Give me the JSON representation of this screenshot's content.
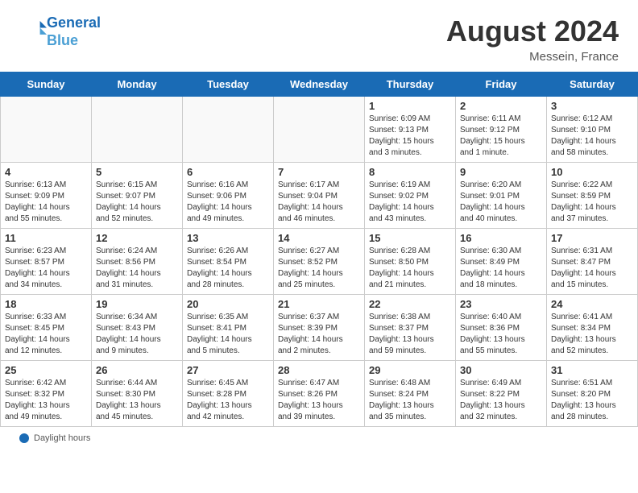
{
  "header": {
    "logo_line1": "General",
    "logo_line2": "Blue",
    "month_title": "August 2024",
    "location": "Messein, France"
  },
  "days_of_week": [
    "Sunday",
    "Monday",
    "Tuesday",
    "Wednesday",
    "Thursday",
    "Friday",
    "Saturday"
  ],
  "footer": {
    "label": "Daylight hours"
  },
  "weeks": [
    [
      {
        "day": "",
        "info": ""
      },
      {
        "day": "",
        "info": ""
      },
      {
        "day": "",
        "info": ""
      },
      {
        "day": "",
        "info": ""
      },
      {
        "day": "1",
        "info": "Sunrise: 6:09 AM\nSunset: 9:13 PM\nDaylight: 15 hours\nand 3 minutes."
      },
      {
        "day": "2",
        "info": "Sunrise: 6:11 AM\nSunset: 9:12 PM\nDaylight: 15 hours\nand 1 minute."
      },
      {
        "day": "3",
        "info": "Sunrise: 6:12 AM\nSunset: 9:10 PM\nDaylight: 14 hours\nand 58 minutes."
      }
    ],
    [
      {
        "day": "4",
        "info": "Sunrise: 6:13 AM\nSunset: 9:09 PM\nDaylight: 14 hours\nand 55 minutes."
      },
      {
        "day": "5",
        "info": "Sunrise: 6:15 AM\nSunset: 9:07 PM\nDaylight: 14 hours\nand 52 minutes."
      },
      {
        "day": "6",
        "info": "Sunrise: 6:16 AM\nSunset: 9:06 PM\nDaylight: 14 hours\nand 49 minutes."
      },
      {
        "day": "7",
        "info": "Sunrise: 6:17 AM\nSunset: 9:04 PM\nDaylight: 14 hours\nand 46 minutes."
      },
      {
        "day": "8",
        "info": "Sunrise: 6:19 AM\nSunset: 9:02 PM\nDaylight: 14 hours\nand 43 minutes."
      },
      {
        "day": "9",
        "info": "Sunrise: 6:20 AM\nSunset: 9:01 PM\nDaylight: 14 hours\nand 40 minutes."
      },
      {
        "day": "10",
        "info": "Sunrise: 6:22 AM\nSunset: 8:59 PM\nDaylight: 14 hours\nand 37 minutes."
      }
    ],
    [
      {
        "day": "11",
        "info": "Sunrise: 6:23 AM\nSunset: 8:57 PM\nDaylight: 14 hours\nand 34 minutes."
      },
      {
        "day": "12",
        "info": "Sunrise: 6:24 AM\nSunset: 8:56 PM\nDaylight: 14 hours\nand 31 minutes."
      },
      {
        "day": "13",
        "info": "Sunrise: 6:26 AM\nSunset: 8:54 PM\nDaylight: 14 hours\nand 28 minutes."
      },
      {
        "day": "14",
        "info": "Sunrise: 6:27 AM\nSunset: 8:52 PM\nDaylight: 14 hours\nand 25 minutes."
      },
      {
        "day": "15",
        "info": "Sunrise: 6:28 AM\nSunset: 8:50 PM\nDaylight: 14 hours\nand 21 minutes."
      },
      {
        "day": "16",
        "info": "Sunrise: 6:30 AM\nSunset: 8:49 PM\nDaylight: 14 hours\nand 18 minutes."
      },
      {
        "day": "17",
        "info": "Sunrise: 6:31 AM\nSunset: 8:47 PM\nDaylight: 14 hours\nand 15 minutes."
      }
    ],
    [
      {
        "day": "18",
        "info": "Sunrise: 6:33 AM\nSunset: 8:45 PM\nDaylight: 14 hours\nand 12 minutes."
      },
      {
        "day": "19",
        "info": "Sunrise: 6:34 AM\nSunset: 8:43 PM\nDaylight: 14 hours\nand 9 minutes."
      },
      {
        "day": "20",
        "info": "Sunrise: 6:35 AM\nSunset: 8:41 PM\nDaylight: 14 hours\nand 5 minutes."
      },
      {
        "day": "21",
        "info": "Sunrise: 6:37 AM\nSunset: 8:39 PM\nDaylight: 14 hours\nand 2 minutes."
      },
      {
        "day": "22",
        "info": "Sunrise: 6:38 AM\nSunset: 8:37 PM\nDaylight: 13 hours\nand 59 minutes."
      },
      {
        "day": "23",
        "info": "Sunrise: 6:40 AM\nSunset: 8:36 PM\nDaylight: 13 hours\nand 55 minutes."
      },
      {
        "day": "24",
        "info": "Sunrise: 6:41 AM\nSunset: 8:34 PM\nDaylight: 13 hours\nand 52 minutes."
      }
    ],
    [
      {
        "day": "25",
        "info": "Sunrise: 6:42 AM\nSunset: 8:32 PM\nDaylight: 13 hours\nand 49 minutes."
      },
      {
        "day": "26",
        "info": "Sunrise: 6:44 AM\nSunset: 8:30 PM\nDaylight: 13 hours\nand 45 minutes."
      },
      {
        "day": "27",
        "info": "Sunrise: 6:45 AM\nSunset: 8:28 PM\nDaylight: 13 hours\nand 42 minutes."
      },
      {
        "day": "28",
        "info": "Sunrise: 6:47 AM\nSunset: 8:26 PM\nDaylight: 13 hours\nand 39 minutes."
      },
      {
        "day": "29",
        "info": "Sunrise: 6:48 AM\nSunset: 8:24 PM\nDaylight: 13 hours\nand 35 minutes."
      },
      {
        "day": "30",
        "info": "Sunrise: 6:49 AM\nSunset: 8:22 PM\nDaylight: 13 hours\nand 32 minutes."
      },
      {
        "day": "31",
        "info": "Sunrise: 6:51 AM\nSunset: 8:20 PM\nDaylight: 13 hours\nand 28 minutes."
      }
    ]
  ]
}
